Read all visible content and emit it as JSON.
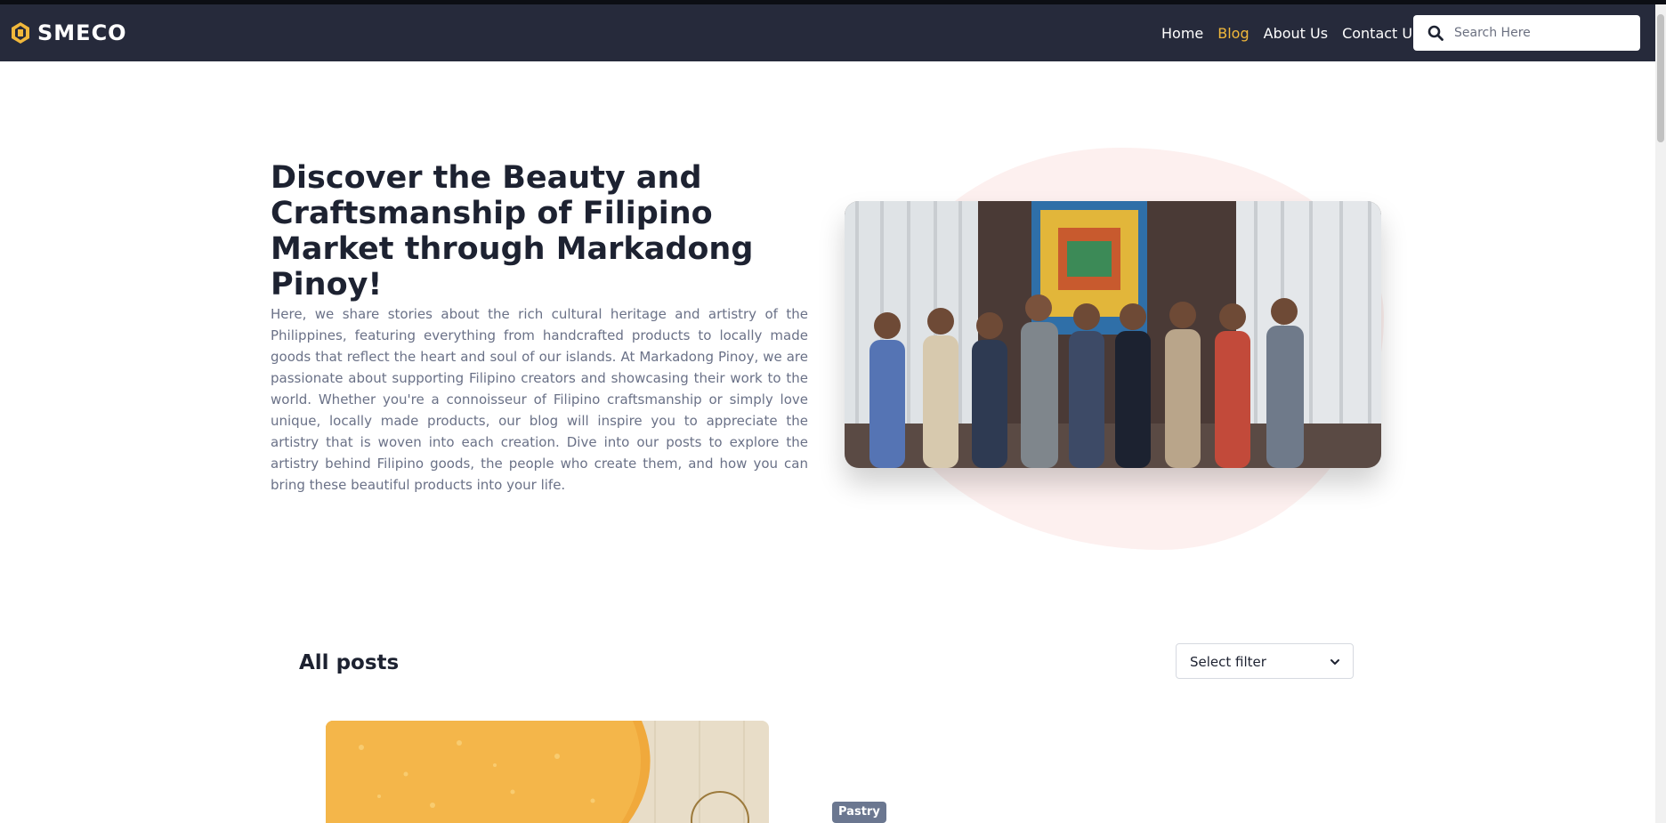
{
  "header": {
    "brand": "SMECO",
    "nav": [
      {
        "label": "Home",
        "active": false
      },
      {
        "label": "Blog",
        "active": true
      },
      {
        "label": "About Us",
        "active": false
      },
      {
        "label": "Contact Us",
        "active": false
      }
    ],
    "search": {
      "placeholder": "Search Here",
      "value": ""
    }
  },
  "hero": {
    "title": "Discover the Beauty and Craftsmanship of Filipino Market through Markadong Pinoy!",
    "body": "Here, we share stories about the rich cultural heritage and artistry of the Philippines, featuring everything from handcrafted products to locally made goods that reflect the heart and soul of our islands. At Markadong Pinoy, we are passionate about supporting Filipino creators and showcasing their work to the world. Whether you're a connoisseur of Filipino craftsmanship or simply love unique, locally made products, our blog will inspire you to appreciate the artistry that is woven into each creation. Dive into our posts to explore the artistry behind Filipino goods, the people who create them, and how you can bring these beautiful products into your life."
  },
  "posts": {
    "title": "All posts",
    "filter": {
      "label": "Select filter"
    },
    "items": [
      {
        "tag": "Pastry"
      }
    ]
  },
  "colors": {
    "navbar": "#262a3b",
    "accent": "#f1b83b",
    "blob": "#fdf0ef",
    "tag": "#6b7790"
  },
  "icons": [
    "brand-logo-icon",
    "search-icon",
    "chevron-down-icon"
  ]
}
